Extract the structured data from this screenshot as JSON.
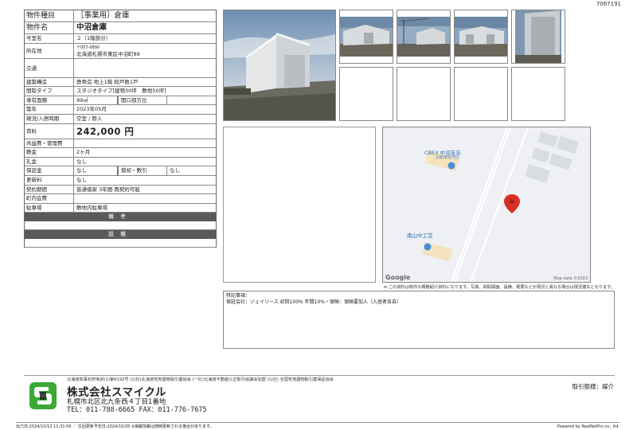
{
  "doc_id": "7067191",
  "property": {
    "type_label": "物件種目",
    "type_value": "［事業用］倉庫",
    "name_label": "物件名",
    "name_value": "中沼倉庫",
    "unit_label": "号室名",
    "unit_value": "２（1階部分）",
    "address_label": "所在地",
    "zip": "〒007-0890",
    "address": "北海道札幌市東区中沼町89",
    "access_label": "交通",
    "access_value": "",
    "structure_label": "建築構造",
    "structure_value": "鉄骨造  地上1階  総戸数1戸",
    "layout_label": "間取タイプ",
    "layout_value": "スタジオタイプ[建物30坪　敷地50坪]",
    "area_label": "専有面積",
    "area_value": "99㎡",
    "direction_label": "開口部方位",
    "direction_value": "",
    "built_label": "築年",
    "built_value": "2023年05月",
    "status_label": "現況/入居時期",
    "status_value": "空室 / 即入",
    "rent_label": "賃料",
    "rent_value": "242,000 円",
    "common_label": "共益費・管理費",
    "common_value": "",
    "deposit_label": "敷金",
    "deposit_value": "2ヶ月",
    "key_label": "礼金",
    "key_value": "なし",
    "guarantee_label": "保証金",
    "guarantee_value": "なし",
    "amort_label": "償却・敷引",
    "amort_value": "なし",
    "renewal_label": "更新料",
    "renewal_value": "なし",
    "contract_label": "契約期間",
    "contract_value": "普通借家  3年間  再契約可能",
    "town_label": "町内会費",
    "town_value": "",
    "parking_label": "駐車場",
    "parking_value": "敷地内駐車場",
    "remarks_header": "備考",
    "equipment_header": "設備"
  },
  "map": {
    "poi1": "CBEX 中沼支店",
    "poi1_sub": "自動車販売店",
    "poi2": "南山中工営",
    "google": "Google",
    "mapdata": "Map data ©2023"
  },
  "disclaimer": "※ この資料は物件の概略紹介資料になります。写真、間取図面、設備、概要などが現況と異なる場合は現況優先となります。",
  "notes": {
    "title": "特記事項：",
    "text": "保証会社：ジェイリース  初回100%  年間10%・保険：保険要加入（入居者各自）"
  },
  "company": {
    "license": "北海道知事石狩免許(1)第9192号 (公社)北海道宅地建物取引業協会 (一社)北海道不動産公正取引協議会加盟 (公社) 全国宅地建物取引業保証協会",
    "name": "株式会社スマイクル",
    "address": "札幌市北区北九条西４丁目1番地",
    "tel": "TEL：011-788-6665  FAX：011-776-7675",
    "deal_type": "取引態様：媒介"
  },
  "footer": {
    "left": "出力日:2024/10/12 11:31:56 ／ 次回更新予定日:2024/10/26 ※掲載情報は随時更新される場合があります。",
    "right": "Powered by RealNetPro co., ltd."
  },
  "colors": {
    "header_bar": "#5a5a5a",
    "logo_green": "#3aa935",
    "pin_red": "#d93025"
  }
}
